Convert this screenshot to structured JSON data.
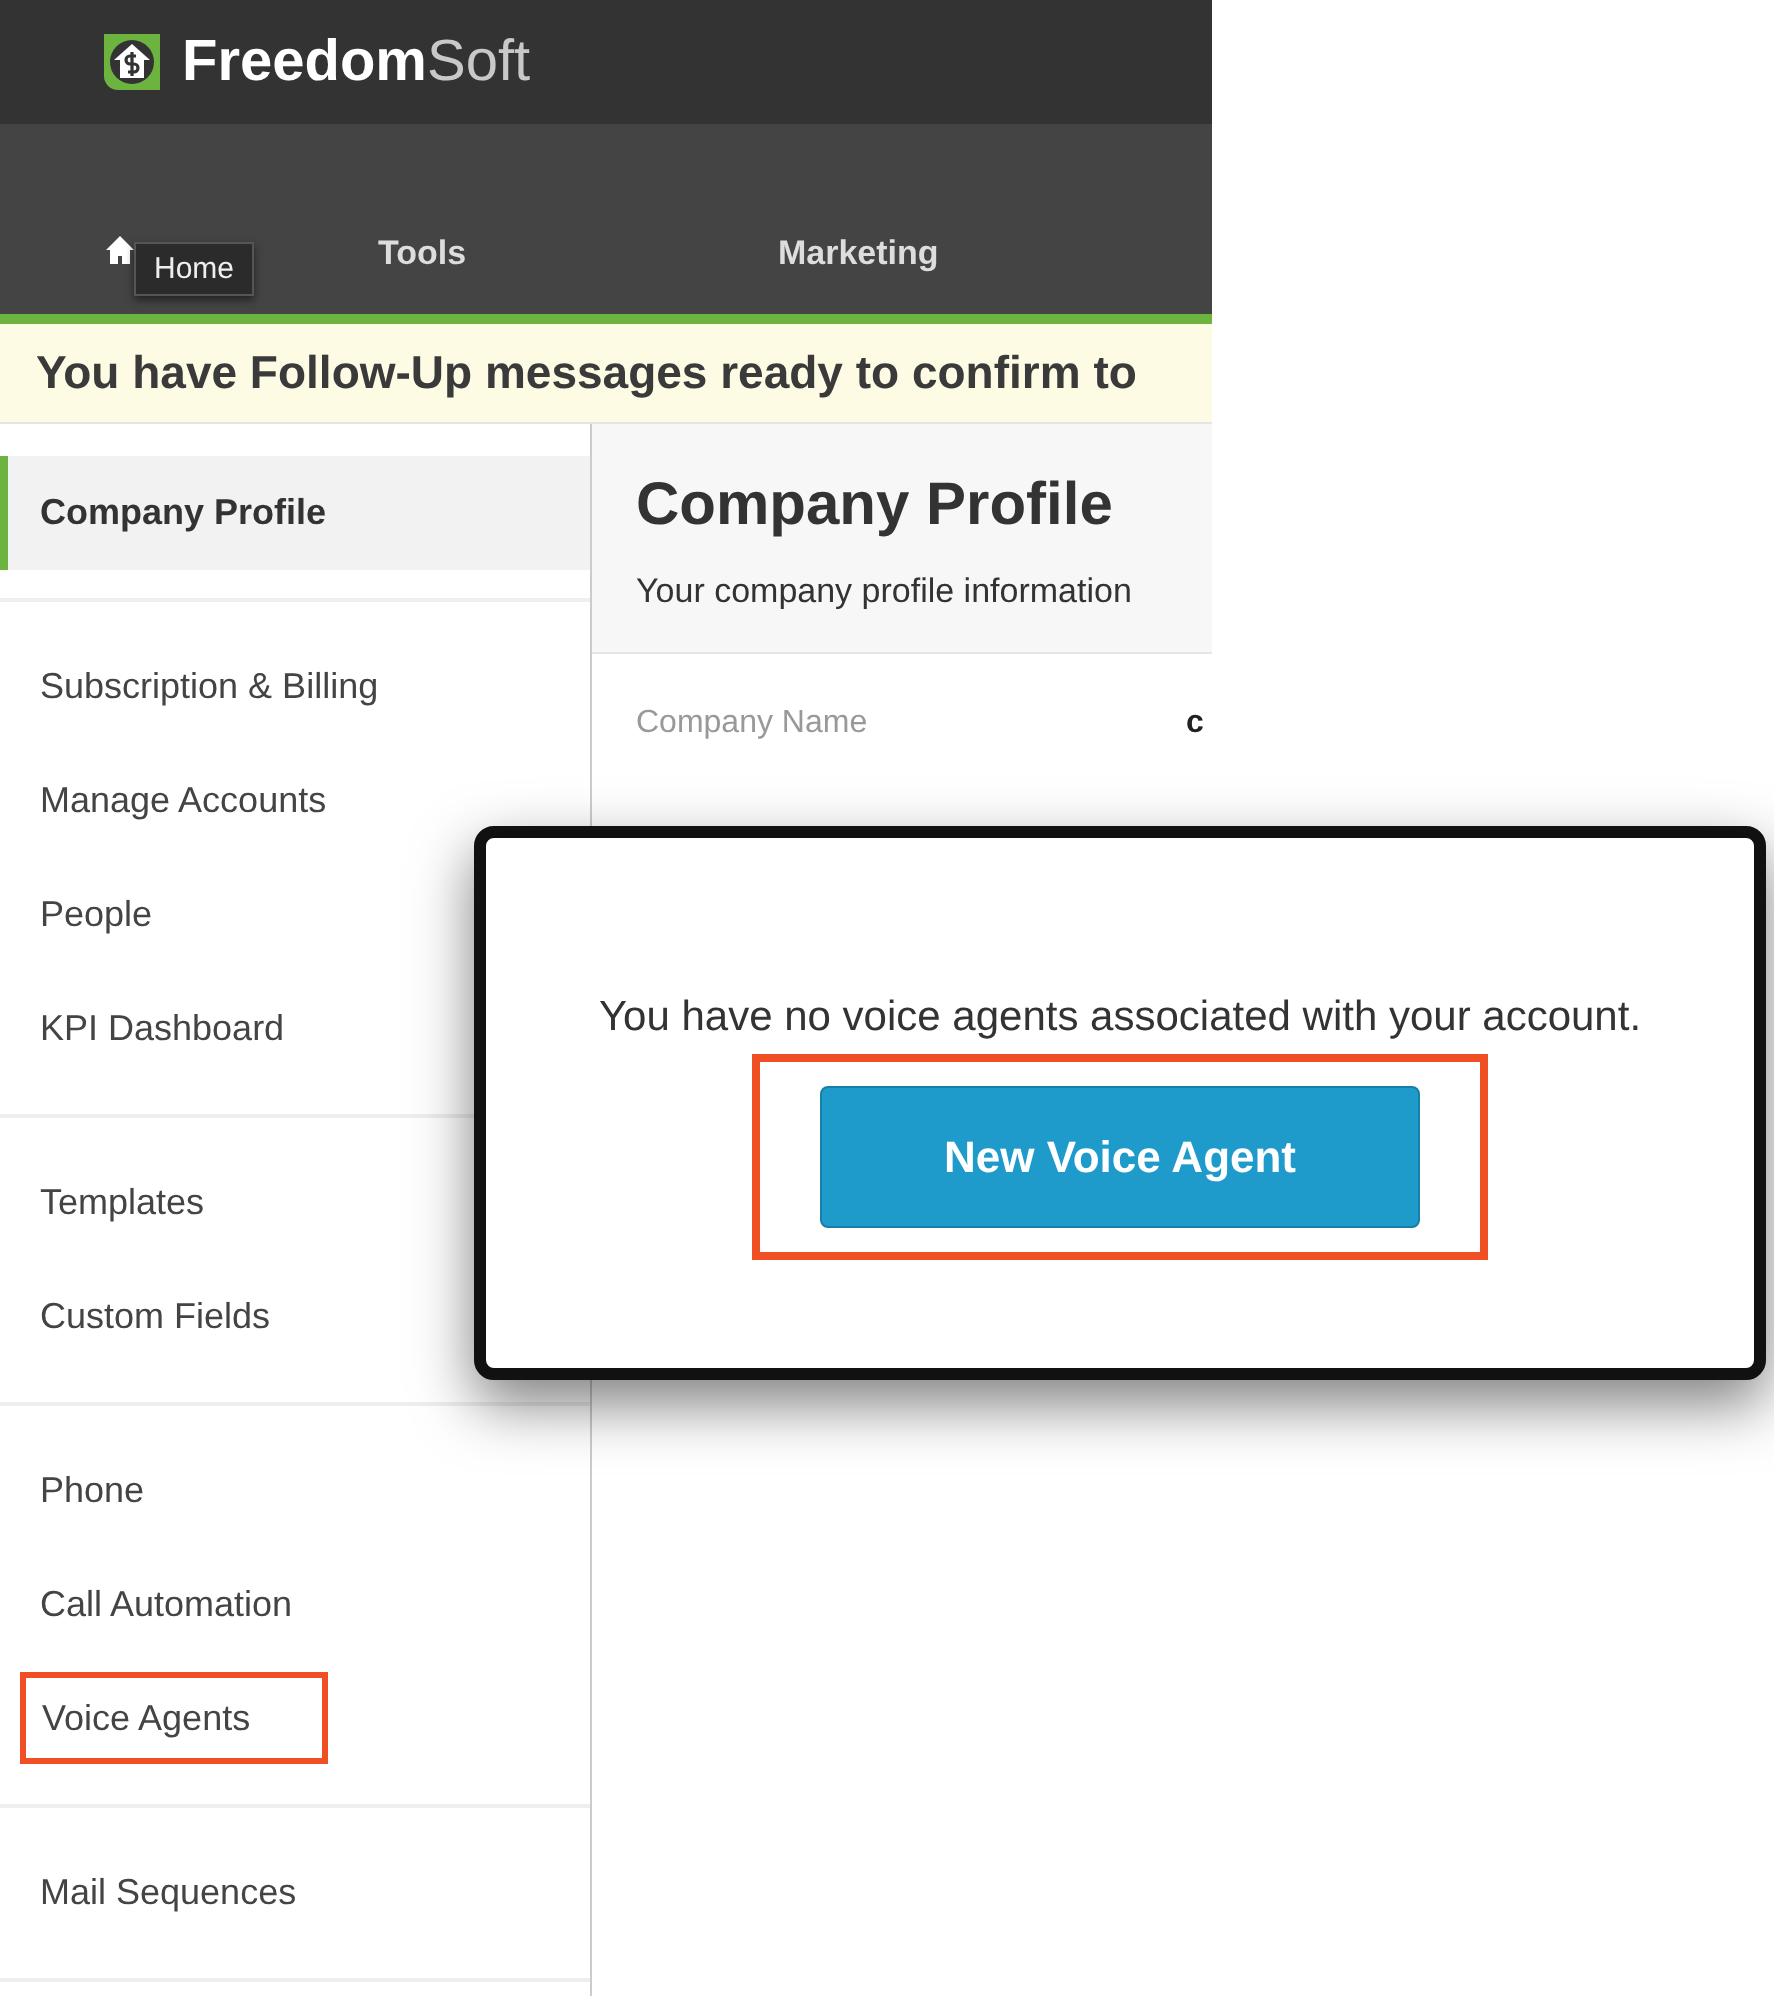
{
  "brand": {
    "name_bold": "Freedom",
    "name_light": "Soft"
  },
  "nav": {
    "items": [
      {
        "label": "Tools"
      },
      {
        "label": "Marketing"
      }
    ],
    "tooltip": "Home"
  },
  "banner": "You have Follow-Up messages ready to confirm to",
  "sidebar": {
    "groups": [
      [
        {
          "label": "Company Profile",
          "selected": true,
          "highlighted": false
        }
      ],
      [
        {
          "label": "Subscription & Billing",
          "selected": false,
          "highlighted": false
        },
        {
          "label": "Manage Accounts",
          "selected": false,
          "highlighted": false
        },
        {
          "label": "People",
          "selected": false,
          "highlighted": false
        },
        {
          "label": "KPI Dashboard",
          "selected": false,
          "highlighted": false
        }
      ],
      [
        {
          "label": "Templates",
          "selected": false,
          "highlighted": false
        },
        {
          "label": "Custom Fields",
          "selected": false,
          "highlighted": false
        }
      ],
      [
        {
          "label": "Phone",
          "selected": false,
          "highlighted": false
        },
        {
          "label": "Call Automation",
          "selected": false,
          "highlighted": false
        },
        {
          "label": "Voice Agents",
          "selected": false,
          "highlighted": true
        }
      ],
      [
        {
          "label": "Mail Sequences",
          "selected": false,
          "highlighted": false
        }
      ]
    ]
  },
  "main": {
    "title": "Company Profile",
    "subtitle": "Your company profile information",
    "fields": [
      {
        "label": "Company Name",
        "value": "c"
      }
    ]
  },
  "popup": {
    "message": "You have no voice agents associated with your account.",
    "button": "New Voice Agent",
    "button_highlighted": true
  }
}
